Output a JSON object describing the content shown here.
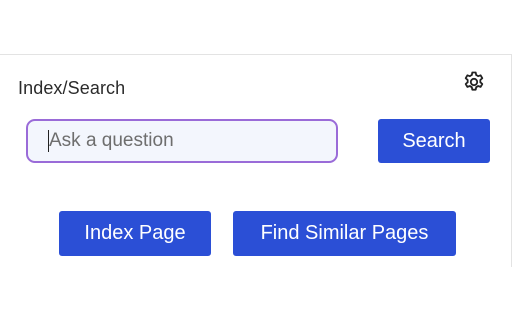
{
  "panel": {
    "title": "Index/Search",
    "settings_icon": "gear-icon"
  },
  "search": {
    "placeholder": "Ask a question",
    "value": "",
    "button_label": "Search"
  },
  "actions": {
    "index_label": "Index Page",
    "similar_label": "Find Similar Pages"
  },
  "colors": {
    "primary_button": "#2b4fd6",
    "input_border_focus": "#9a6bd8",
    "input_background": "#f3f6fd"
  }
}
